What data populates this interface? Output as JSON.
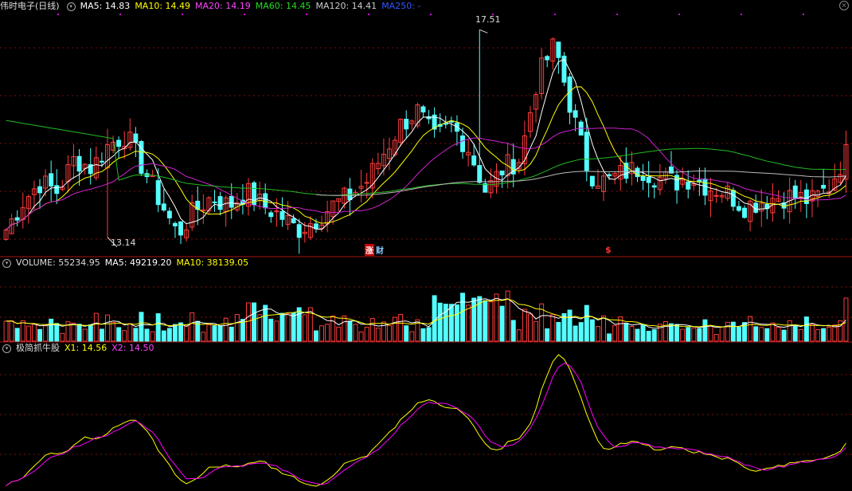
{
  "main_header": {
    "title": "伟时电子(日线)",
    "ma5": "MA5: 14.83",
    "ma10": "MA10: 14.49",
    "ma20": "MA20: 14.19",
    "ma60": "MA60: 14.45",
    "ma120": "MA120: 14.41",
    "ma250": "MA250: -"
  },
  "volume_header": {
    "volume": "VOLUME: 55234.95",
    "ma5": "MA5: 49219.20",
    "ma10": "MA10: 38139.05"
  },
  "indicator_header": {
    "name": "极简抓牛股",
    "x1": "X1: 14.56",
    "x2": "X2: 14.50"
  },
  "annotations": {
    "high_label": "17.51",
    "low_label": "13.14",
    "tag_zhang": "涨",
    "tag_cai": "财",
    "tag_dollar": "$"
  },
  "colors": {
    "up": "#ff3c3c",
    "down": "#54ffff",
    "ma5": "#ffffff",
    "ma10": "#ffff00",
    "ma20": "#ff00ff",
    "ma60": "#00dd00",
    "ma120": "#bbbbbb",
    "ma250": "#3333ff",
    "grid": "#7a1010"
  },
  "chart_data": {
    "type": "candlestick",
    "price_range": [
      12.8,
      17.8
    ],
    "high": 17.51,
    "low": 13.14,
    "candle_close_trend": [
      13.3,
      13.9,
      14.3,
      14.1,
      14.8,
      14.6,
      15.1,
      15.3,
      14.6,
      13.9,
      13.2,
      13.7,
      14.0,
      13.8,
      14.1,
      13.8,
      13.6,
      13.3,
      13.5,
      13.8,
      14.0,
      14.3,
      14.9,
      15.5,
      15.8,
      15.2,
      15.5,
      15.0,
      14.1,
      14.6,
      14.8,
      16.5,
      17.2,
      15.8,
      14.5,
      14.3,
      14.5,
      14.6,
      14.4,
      14.3,
      14.4,
      14.2,
      14.1,
      13.8,
      13.9,
      14.0,
      14.0,
      13.9,
      14.2,
      14.9
    ],
    "volume_current": 55234.95,
    "volume_ma5": 49219.2,
    "volume_ma10": 38139.05,
    "indicator_x1": 14.56,
    "indicator_x2": 14.5
  }
}
